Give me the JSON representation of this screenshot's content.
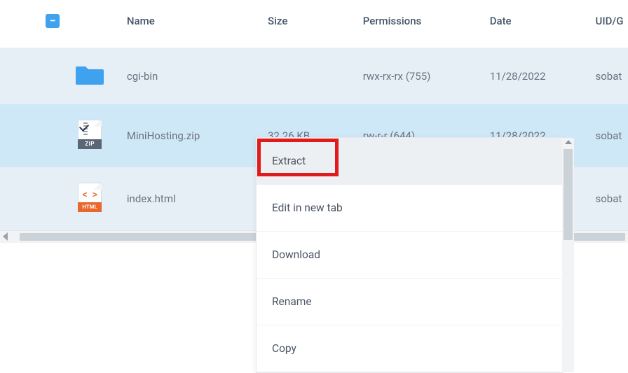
{
  "headers": {
    "name": "Name",
    "size": "Size",
    "permissions": "Permissions",
    "date": "Date",
    "uid": "UID/G"
  },
  "rows": [
    {
      "icon": "folder",
      "name": "cgi-bin",
      "size": "",
      "permissions": "rwx-rx-rx (755)",
      "date": "11/28/2022",
      "uid": "sobat"
    },
    {
      "icon": "zip",
      "name": "MiniHosting.zip",
      "size": "32.26 KB",
      "permissions": "rw-r-r (644)",
      "date": "11/28/2022",
      "uid": "sobat"
    },
    {
      "icon": "html",
      "name": "index.html",
      "size": "",
      "permissions": "",
      "date": "",
      "uid": "sobat"
    }
  ],
  "contextMenu": {
    "items": [
      {
        "label": "Extract"
      },
      {
        "label": "Edit in new tab"
      },
      {
        "label": "Download"
      },
      {
        "label": "Rename"
      },
      {
        "label": "Copy"
      }
    ]
  },
  "iconBadges": {
    "zip": "ZIP",
    "html": "HTML",
    "code": "< >"
  }
}
